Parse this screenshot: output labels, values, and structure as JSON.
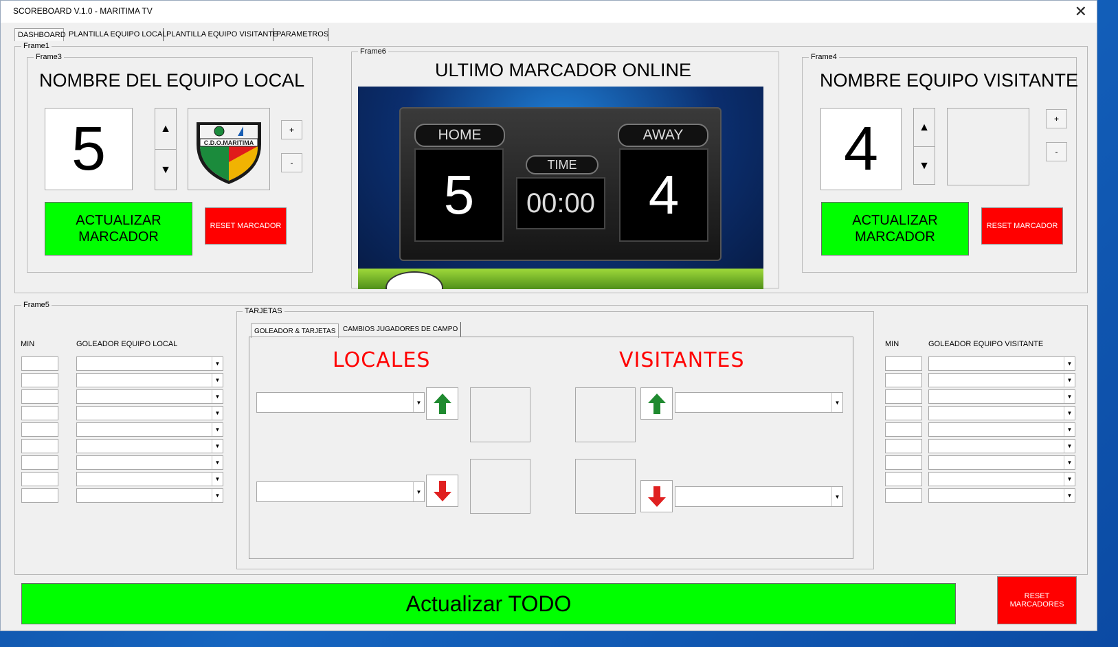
{
  "window": {
    "title": "SCOREBOARD V.1.0 - MARITIMA TV",
    "close_glyph": "✕"
  },
  "tabs": [
    "DASHBOARD",
    "PLANTILLA EQUIPO LOCAL",
    "PLANTILLA EQUIPO VISITANTE",
    "PARAMETROS"
  ],
  "frames": {
    "frame1": "Frame1",
    "frame3": "Frame3",
    "frame4": "Frame4",
    "frame5": "Frame5",
    "frame6": "Frame6",
    "tarjetas": "TARJETAS"
  },
  "local": {
    "team_name": "NOMBRE DEL EQUIPO LOCAL",
    "score": "5",
    "logo_text": "C.D.O.MARITIMA",
    "plus": "+",
    "minus": "-",
    "update_label": "ACTUALIZAR MARCADOR",
    "reset_label": "RESET MARCADOR"
  },
  "visitor": {
    "team_name": "NOMBRE EQUIPO VISITANTE",
    "score": "4",
    "plus": "+",
    "minus": "-",
    "update_label": "ACTUALIZAR MARCADOR",
    "reset_label": "RESET MARCADOR"
  },
  "online": {
    "title": "ULTIMO MARCADOR ONLINE",
    "home_label": "HOME",
    "away_label": "AWAY",
    "time_label": "TIME",
    "home_score": "5",
    "away_score": "4",
    "time": "00:00"
  },
  "scorers": {
    "min_header": "MIN",
    "local_header": "GOLEADOR EQUIPO LOCAL",
    "visitor_header": "GOLEADOR EQUIPO VISITANTE",
    "rows": 9
  },
  "cards": {
    "subtabs": [
      "GOLEADOR & TARJETAS",
      "CAMBIOS JUGADORES DE CAMPO"
    ],
    "locales": "LOCALES",
    "visitantes": "VISITANTES"
  },
  "footer": {
    "update_all": "Actualizar TODO",
    "reset_all": "RESET MARCADORES"
  },
  "colors": {
    "green": "#00ff00",
    "red": "#ff0000",
    "team_label": "#ff0000"
  }
}
